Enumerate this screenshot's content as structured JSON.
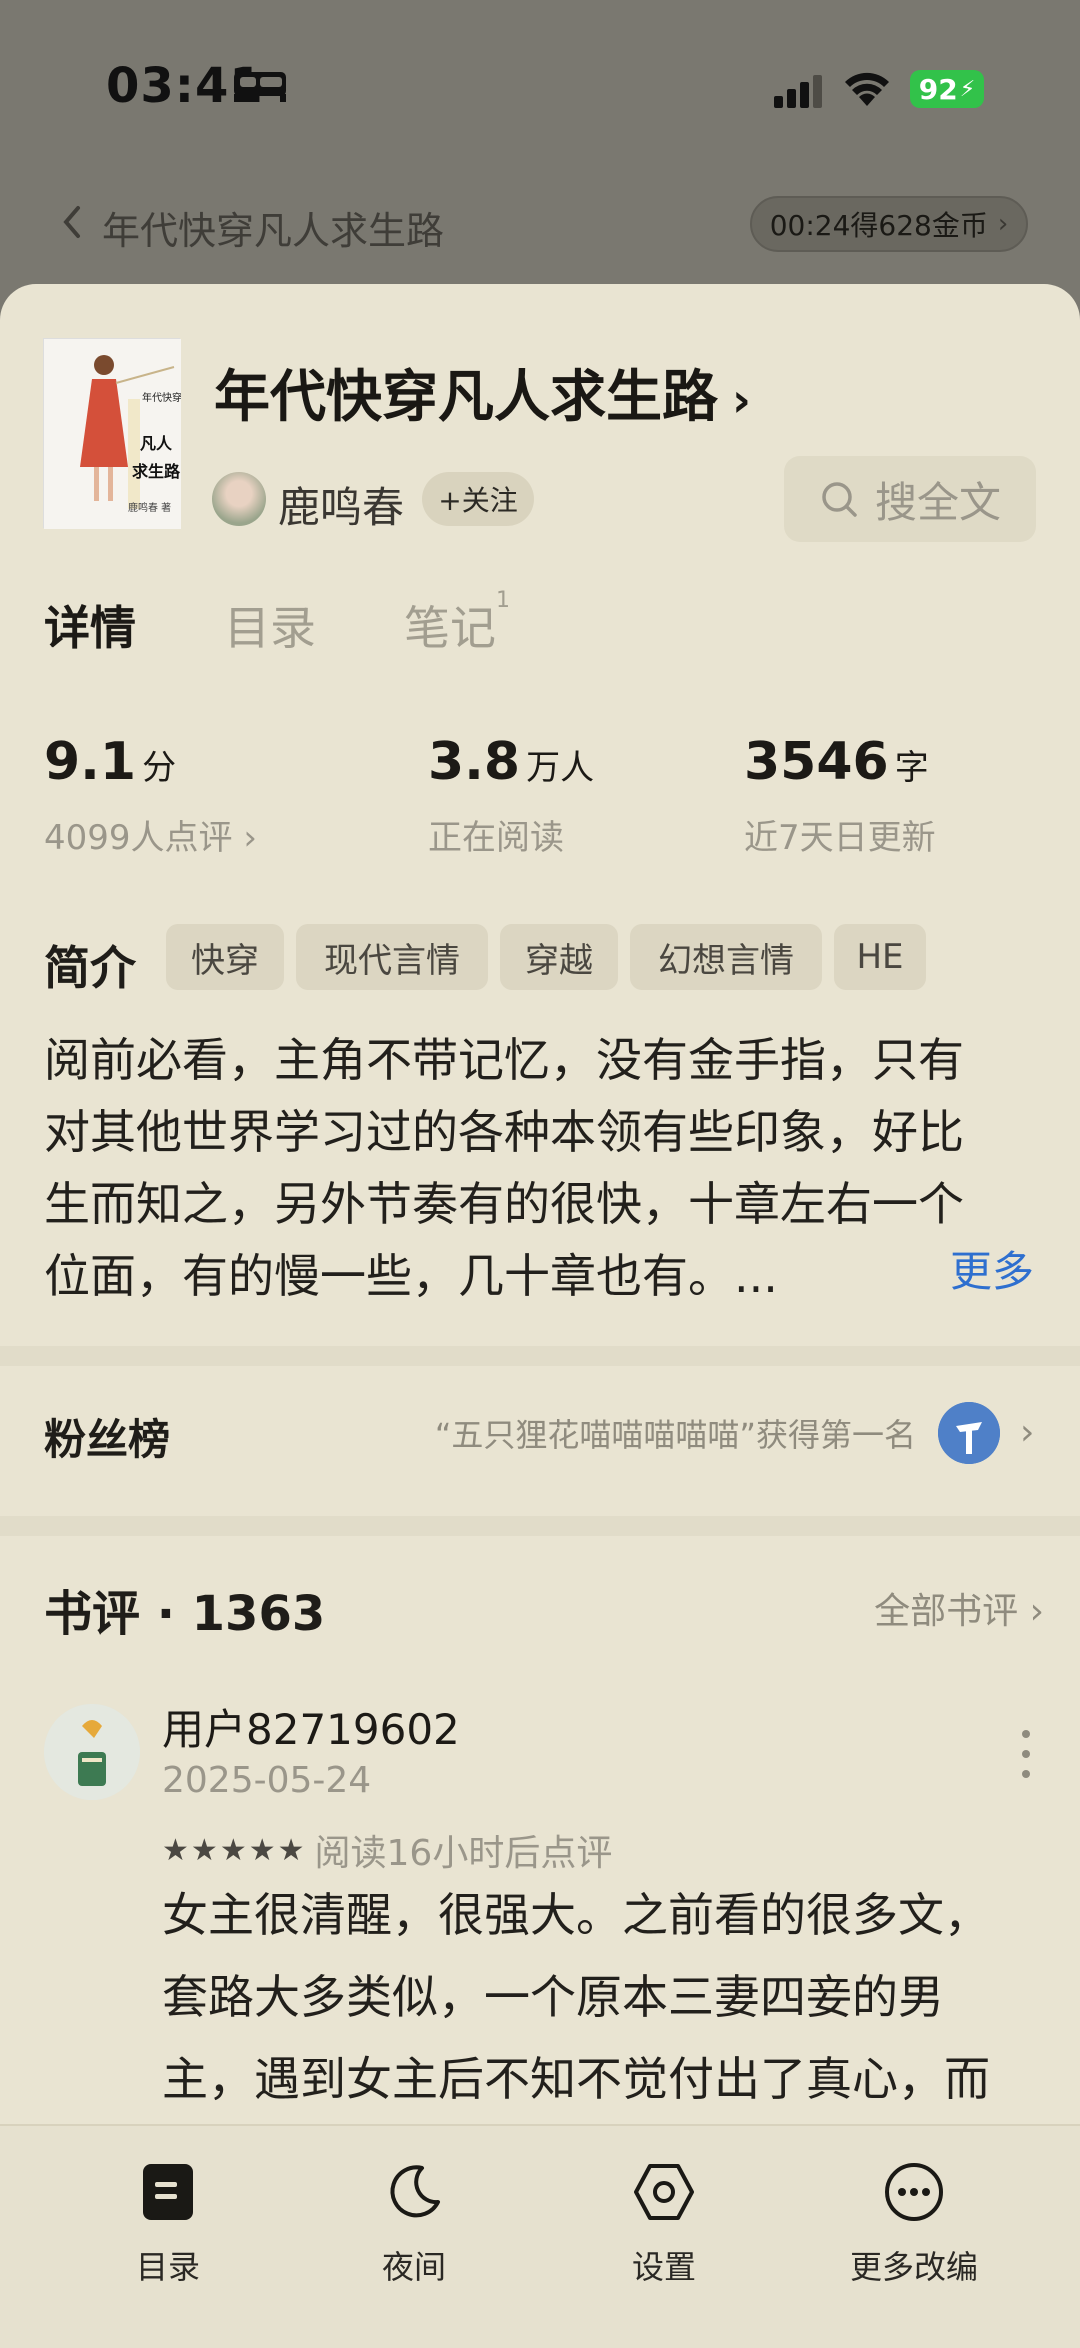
{
  "status_bar": {
    "time": "03:41",
    "battery": "92"
  },
  "reader_header": {
    "book_title": "年代快穿凡人求生路",
    "coin_timer": "00:24得628金币"
  },
  "book": {
    "title": "年代快穿凡人求生路",
    "author": "鹿鸣春",
    "follow_label": "+关注",
    "search_label": "搜全文",
    "cover_lines": [
      "年代快穿",
      "凡人",
      "求生路",
      "鹿鸣春 著"
    ]
  },
  "tabs": {
    "detail": "详情",
    "toc": "目录",
    "notes": "笔记",
    "notes_count": "1"
  },
  "stats": [
    {
      "value": "9.1",
      "unit": "分",
      "sub": "4099人点评 ›"
    },
    {
      "value": "3.8",
      "unit": "万人",
      "sub": "正在阅读"
    },
    {
      "value": "3546",
      "unit": "字",
      "sub": "近7天日更新"
    }
  ],
  "intro": {
    "label": "简介",
    "tags": [
      "快穿",
      "现代言情",
      "穿越",
      "幻想言情",
      "HE"
    ],
    "lines": [
      "阅前必看，主角不带记忆，没有金手指，只有",
      "对其他世界学习过的各种本领有些印象，好比",
      "生而知之，另外节奏有的很快，十章左右一个",
      "位面，有的慢一些，几十章也有。..."
    ],
    "more": "更多"
  },
  "fans": {
    "label": "粉丝榜",
    "note": "“五只狸花喵喵喵喵喵”获得第一名"
  },
  "reviews": {
    "header": "书评 · 1363",
    "all_label": "全部书评 ›",
    "items": [
      {
        "user": "用户82719602",
        "date": "2025-05-24",
        "stars": 5,
        "note": "阅读16小时后点评",
        "lines": [
          "女主很清醒，很强大。之前看的很多文，",
          "套路大多类似，一个原本三妻四妾的男",
          "主，遇到女主后不知不觉付出了真心，而"
        ]
      }
    ]
  },
  "bottom_nav": [
    {
      "label": "目录",
      "icon": "toc-icon"
    },
    {
      "label": "夜间",
      "icon": "moon-icon"
    },
    {
      "label": "设置",
      "icon": "settings-icon"
    },
    {
      "label": "更多改编",
      "icon": "more-icon"
    }
  ],
  "colors": {
    "sheet_bg": "#e9e4d2",
    "dim_bg": "#7a7870",
    "link_blue": "#2e6fcf",
    "battery_green": "#32c24a"
  }
}
